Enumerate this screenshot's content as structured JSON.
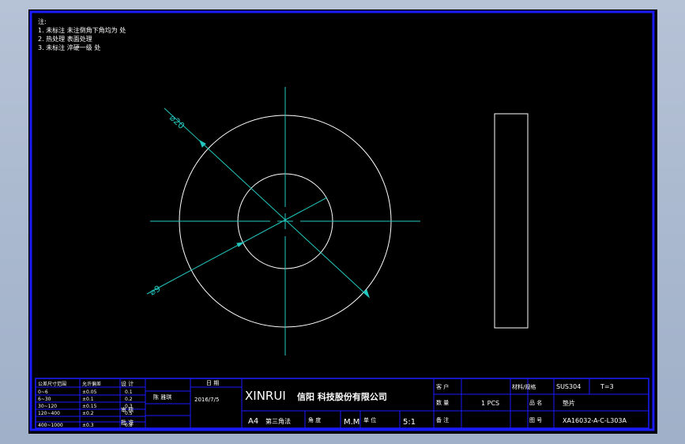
{
  "drawing": {
    "notes": [
      "注:",
      "1. 未标注 未注倒角下角均为 处",
      "2. 热处理 表面处理",
      "3. 未标注 淬硬一级 处"
    ],
    "dimensions": {
      "outer": "⌀20",
      "inner": "⌀9"
    }
  },
  "title_block": {
    "company_latin": "XINRUI",
    "company_cn": "信阳 科技股份有限公司",
    "date": "2016/7/5",
    "paper_size": "A4",
    "projection": "第三角法",
    "unit": "M.M",
    "scale_ratio": "5:1",
    "material": "SUS304",
    "thickness": "T=3",
    "quantity": "1  PCS",
    "part_name": "垫片",
    "part_number": "XA16032-A-C-L303A",
    "labels": {
      "tolerance_head": "公差尺寸范围",
      "tolerance_value_head": "允许偏差",
      "design": "设 计",
      "check": "审 核",
      "approve": "批 准",
      "drafter": "陈 雅琪",
      "date_head": "日 期",
      "angle": "角 度",
      "unit_head": "单 位",
      "scale_head": "比 例",
      "customer": "客 户",
      "material_head": "材料/规格",
      "qty_head": "数 量",
      "name_head": "品 名",
      "remark": "备 注",
      "drawing_no": "图 号"
    },
    "tolerance_rows": [
      [
        "0~6",
        "±0.05",
        "0.1"
      ],
      [
        "6~30",
        "±0.1",
        "0.2"
      ],
      [
        "30~120",
        "±0.15",
        "0.3"
      ],
      [
        "120~400",
        "±0.2",
        "0.5"
      ],
      [
        "400~1000",
        "±0.3",
        "0.8"
      ]
    ]
  },
  "colors": {
    "frame": "#1a1aff",
    "geometry": "#ffffff",
    "centerline": "#22c7c0",
    "background": "#000000"
  }
}
